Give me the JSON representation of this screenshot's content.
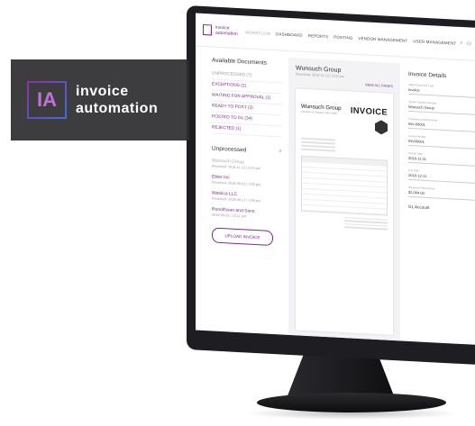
{
  "app": {
    "logo_text": "invoice automation"
  },
  "nav": {
    "items": [
      {
        "label": "WORKFLOW",
        "muted": true
      },
      {
        "label": "DASHBOARD"
      },
      {
        "label": "REPORTS"
      },
      {
        "label": "POSTING"
      },
      {
        "label": "VENDOR MANAGEMENT"
      },
      {
        "label": "USER MANAGEMENT"
      }
    ]
  },
  "documents": {
    "title": "Available Documents",
    "items": [
      "UNPROCESSED (7)",
      "EXCEPTIONS (2)",
      "WAITING FOR APPROVAL (1)",
      "READY TO POST (3)",
      "POSTED TO GL (34)",
      "REJECTED (1)"
    ]
  },
  "unprocessed": {
    "title": "Unprocessed",
    "items": [
      {
        "name": "Wunsuch Group",
        "date": "Received: 2018-11-12 | 3:03 pm",
        "dim": true
      },
      {
        "name": "Ebler Inc",
        "date": "Received: 2018-09-03 | 3:25 pm"
      },
      {
        "name": "Watsica LLC",
        "date": "Received: 2018-09-17 | 3:09 pm"
      },
      {
        "name": "Runolfsson and Sons",
        "date": "2018-09-23 | 12:11 pm"
      }
    ],
    "upload_label": "UPLOAD INVOICE"
  },
  "preview": {
    "title": "Wunsuch Group",
    "subtitle": "Received: 2018-11-12 | 3:03 pm",
    "view_all": "VIEW ALL PAGES",
    "company": "Wunsuch Group",
    "address": "123 Main St. Anytown, USA 12345",
    "heading": "INVOICE"
  },
  "details": {
    "title": "Invoice Details",
    "fields": [
      {
        "label": "Select Document Type",
        "value": "Invoice"
      },
      {
        "label": "Vendor Payment Number",
        "value": "Wunsuch Group"
      },
      {
        "label": "Purchase Invoice Number",
        "value": "INV-00001"
      },
      {
        "label": "Invoice Number",
        "value": "INV00001"
      },
      {
        "label": "Invoice Date",
        "value": "2018-11-11"
      },
      {
        "label": "Due Date",
        "value": "2018-12-11"
      },
      {
        "label": "Document Total Amount",
        "value": "$2,064.00"
      }
    ],
    "gl_title": "GL Account"
  }
}
